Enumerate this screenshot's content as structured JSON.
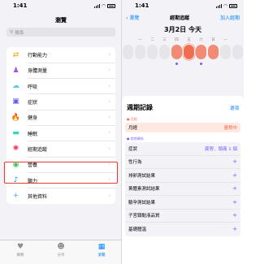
{
  "left": {
    "status_time": "1:41",
    "title": "瀏覽",
    "search_placeholder": "搜尋",
    "categories": [
      {
        "label": "行動能力",
        "icon": "mobility-icon",
        "color": "#ff9f0a",
        "glyph": "⇄"
      },
      {
        "label": "身體測量",
        "icon": "body-measurements-icon",
        "color": "#af52de",
        "glyph": "♟"
      },
      {
        "label": "呼吸",
        "icon": "respiratory-icon",
        "color": "#5ac8fa",
        "glyph": "☁"
      },
      {
        "label": "症狀",
        "icon": "symptoms-icon",
        "color": "#5e5ce6",
        "glyph": "▣"
      },
      {
        "label": "健身",
        "icon": "fitness-icon",
        "color": "#ff6b1a",
        "glyph": "🔥"
      },
      {
        "label": "睡眠",
        "icon": "sleep-icon",
        "color": "#30d5c8",
        "glyph": "▬"
      },
      {
        "label": "經期追蹤",
        "icon": "cycle-tracking-icon",
        "color": "#ff375f",
        "glyph": "✺"
      },
      {
        "label": "營養",
        "icon": "nutrition-icon",
        "color": "#34c759",
        "glyph": "◉"
      },
      {
        "label": "聽力",
        "icon": "hearing-icon",
        "color": "#0a84ff",
        "glyph": "♪"
      },
      {
        "label": "其他資料",
        "icon": "other-data-icon",
        "color": "#5e9cfa",
        "glyph": "+"
      }
    ],
    "tabs": [
      {
        "label": "摘要",
        "icon": "heart-icon",
        "glyph": "♥"
      },
      {
        "label": "分享",
        "icon": "sharing-icon",
        "glyph": "☻"
      },
      {
        "label": "瀏覽",
        "icon": "browse-icon",
        "glyph": "▦"
      }
    ]
  },
  "right": {
    "status_time": "1:41",
    "back_label": "瀏覽",
    "nav_title": "經期追蹤",
    "add_label": "加入經期",
    "date_title": "3月2日 今天",
    "day_letters": [
      "",
      "一",
      "二",
      "三",
      "四",
      "五",
      "六",
      "日",
      "一",
      ""
    ],
    "week_title": "週期記錄",
    "options_label": "選項",
    "period_section": "月經",
    "period_label": "月經",
    "period_status": "量稍中",
    "other_section": "其他資料",
    "records": [
      {
        "label": "症狀",
        "value": "疲勞、頭痛 1 個"
      },
      {
        "label": "性行為",
        "value": "+"
      },
      {
        "label": "排卵測試結果",
        "value": "+"
      },
      {
        "label": "黃體素測試結果",
        "value": "+"
      },
      {
        "label": "驗孕測試結果",
        "value": "+"
      },
      {
        "label": "子宮頸黏液品質",
        "value": "+"
      },
      {
        "label": "基礎體溫",
        "value": "+"
      }
    ]
  }
}
